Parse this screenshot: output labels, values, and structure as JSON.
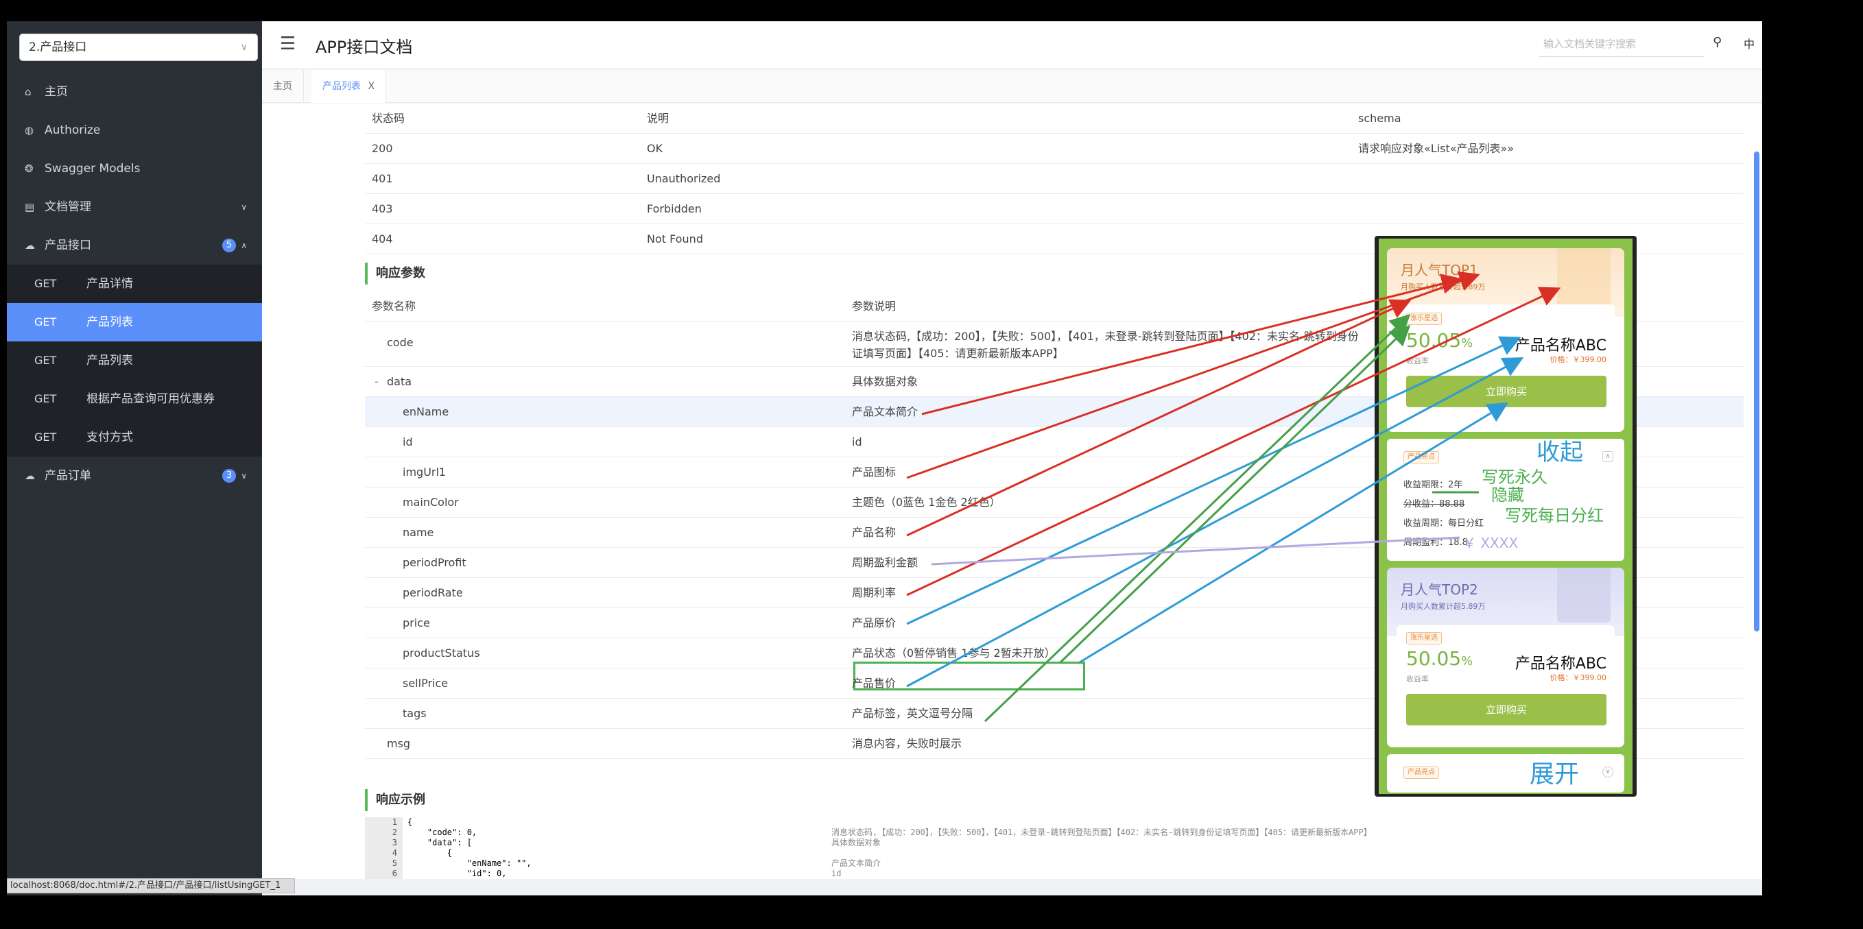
{
  "sidebar": {
    "group_select": "2.产品接口",
    "items": [
      {
        "icon": "home-icon",
        "label": "主页"
      },
      {
        "icon": "authorize-icon",
        "label": "Authorize"
      },
      {
        "icon": "models-icon",
        "label": "Swagger Models"
      },
      {
        "icon": "doc-manage-icon",
        "label": "文档管理"
      },
      {
        "icon": "cloud-icon",
        "label": "产品接口",
        "badge": "5"
      },
      {
        "icon": "cloud-icon",
        "label": "产品订单",
        "badge": "3"
      }
    ],
    "sub_items": [
      {
        "method": "GET",
        "label": "产品详情"
      },
      {
        "method": "GET",
        "label": "产品列表"
      },
      {
        "method": "GET",
        "label": "产品列表"
      },
      {
        "method": "GET",
        "label": "根据产品查询可用优惠券"
      },
      {
        "method": "GET",
        "label": "支付方式"
      }
    ]
  },
  "header": {
    "title": "APP接口文档",
    "search_placeholder": "输入文档关键字搜索",
    "lang": "中"
  },
  "tabs": [
    {
      "label": "主页"
    },
    {
      "label": "产品列表",
      "close": "X"
    }
  ],
  "status_table": {
    "headers": [
      "状态码",
      "说明",
      "schema"
    ],
    "rows": [
      [
        "200",
        "OK",
        "请求响应对象«List«产品列表»»"
      ],
      [
        "401",
        "Unauthorized",
        ""
      ],
      [
        "403",
        "Forbidden",
        ""
      ],
      [
        "404",
        "Not Found",
        ""
      ]
    ]
  },
  "response_params": {
    "title": "响应参数",
    "headers": [
      "参数名称",
      "参数说明"
    ],
    "rows": [
      {
        "name": "code",
        "desc": "消息状态码,【成功：200】，【失败：500】，【401，未登录-跳转到登陆页面】【402：未实名-跳转到身份",
        "desc2": "证填写页面】【405：请更新最新版本APP】"
      },
      {
        "name": "data",
        "desc": "具体数据对象",
        "toggle": "-"
      },
      {
        "name": "enName",
        "desc": "产品文本简介"
      },
      {
        "name": "id",
        "desc": "id"
      },
      {
        "name": "imgUrl1",
        "desc": "产品图标"
      },
      {
        "name": "mainColor",
        "desc": "主题色（0蓝色 1金色 2红色）"
      },
      {
        "name": "name",
        "desc": "产品名称"
      },
      {
        "name": "periodProfit",
        "desc": "周期盈利金额"
      },
      {
        "name": "periodRate",
        "desc": "周期利率"
      },
      {
        "name": "price",
        "desc": "产品原价"
      },
      {
        "name": "productStatus",
        "desc": "产品状态（0暂停销售 1参与 2暂未开放）"
      },
      {
        "name": "sellPrice",
        "desc": "产品售价"
      },
      {
        "name": "tags",
        "desc": "产品标签，英文逗号分隔"
      },
      {
        "name": "msg",
        "desc": "消息内容，失败时展示"
      }
    ]
  },
  "example": {
    "title": "响应示例",
    "line_numbers": [
      "1",
      "2",
      "3",
      "4",
      "5",
      "6"
    ],
    "lines": [
      "{",
      "    \"code\": 0,",
      "    \"data\": [",
      "        {",
      "            \"enName\": \"\",",
      "            \"id\": 0,"
    ],
    "comments": [
      "",
      "消息状态码,【成功：200】，【失败：500】，【401，未登录-跳转到登陆页面】【402：未实名-跳转到身份证填写页面】【405：请更新最新版本APP】",
      "具体数据对象",
      "",
      "产品文本简介",
      "id"
    ]
  },
  "mockup": {
    "card1": {
      "rank": "月人气TOP1",
      "sub": "月购买人数累计超5.89万",
      "tag": "涨乐星选",
      "rate": "50.05",
      "unit": "%",
      "rate_label": "收益率",
      "name": "产品名称ABC",
      "price": "价格：￥399.00",
      "buy": "立即购买"
    },
    "highlight": {
      "tag": "产品亮点",
      "bullets": [
        "收益期限：2年",
        "分收益：88.88",
        "收益周期：每日分红",
        "周期盈利：18.8"
      ]
    },
    "card2": {
      "rank": "月人气TOP2",
      "sub": "月购买人数累计超5.89万",
      "tag": "涨乐星选",
      "rate": "50.05",
      "unit": "%",
      "rate_label": "收益率",
      "name": "产品名称ABC",
      "price": "价格：￥399.00",
      "buy": "立即购买"
    },
    "highlight2": {
      "tag": "产品亮点"
    }
  },
  "annotations": {
    "collapse": "收起",
    "forever": "写死永久",
    "hide": "隐藏",
    "daily": "写死每日分红",
    "xxxx": "￥ XXXX",
    "expand": "展开"
  },
  "status_bar": "localhost:8068/doc.html#/2.产品接口/产品接口/listUsingGET_1"
}
